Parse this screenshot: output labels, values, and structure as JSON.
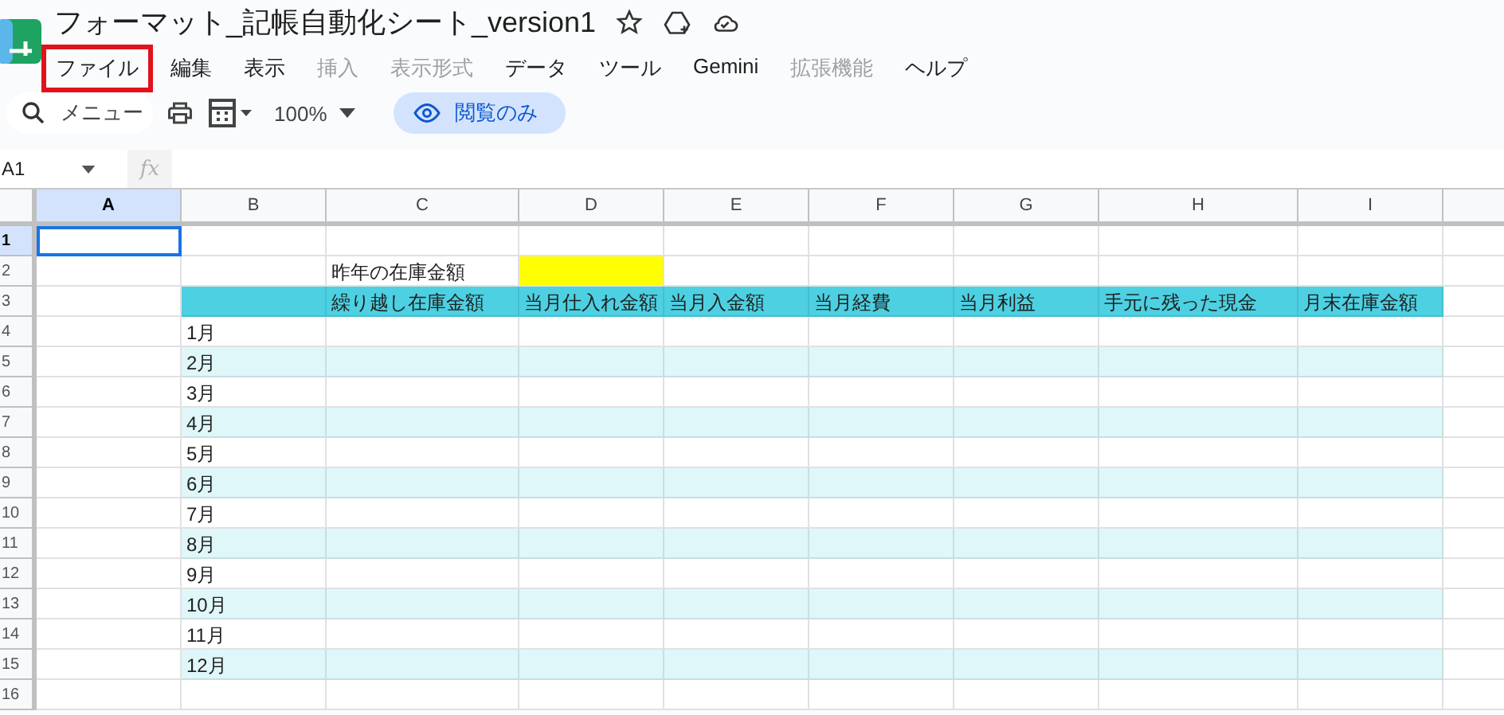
{
  "document": {
    "title": "フォーマット_記帳自動化シート_version1"
  },
  "menu": [
    {
      "label": "ファイル",
      "disabled": false,
      "highlighted": true
    },
    {
      "label": "編集",
      "disabled": false,
      "highlighted": false
    },
    {
      "label": "表示",
      "disabled": false,
      "highlighted": false
    },
    {
      "label": "挿入",
      "disabled": true,
      "highlighted": false
    },
    {
      "label": "表示形式",
      "disabled": true,
      "highlighted": false
    },
    {
      "label": "データ",
      "disabled": false,
      "highlighted": false
    },
    {
      "label": "ツール",
      "disabled": false,
      "highlighted": false
    },
    {
      "label": "Gemini",
      "disabled": false,
      "highlighted": false
    },
    {
      "label": "拡張機能",
      "disabled": true,
      "highlighted": false
    },
    {
      "label": "ヘルプ",
      "disabled": false,
      "highlighted": false
    }
  ],
  "toolbar": {
    "search_placeholder": "メニュー",
    "zoom": "100%",
    "view_only": "閲覧のみ"
  },
  "formula_bar": {
    "name_box": "A1",
    "fx": "fx"
  },
  "columns": [
    {
      "label": "A",
      "selected": true
    },
    {
      "label": "B",
      "selected": false
    },
    {
      "label": "C",
      "selected": false
    },
    {
      "label": "D",
      "selected": false
    },
    {
      "label": "E",
      "selected": false
    },
    {
      "label": "F",
      "selected": false
    },
    {
      "label": "G",
      "selected": false
    },
    {
      "label": "H",
      "selected": false
    },
    {
      "label": "I",
      "selected": false
    }
  ],
  "rows": [
    {
      "number": "1",
      "selected": true,
      "cells": [
        {
          "kind": "plain"
        },
        {
          "kind": "plain"
        },
        {
          "kind": "plain"
        },
        {
          "kind": "plain"
        },
        {
          "kind": "plain"
        },
        {
          "kind": "plain"
        },
        {
          "kind": "plain"
        },
        {
          "kind": "plain"
        },
        {
          "kind": "plain"
        }
      ]
    },
    {
      "number": "2",
      "selected": false,
      "cells": [
        {
          "kind": "plain"
        },
        {
          "kind": "plain"
        },
        {
          "kind": "plain",
          "text": "昨年の在庫金額"
        },
        {
          "kind": "highlight"
        },
        {
          "kind": "plain"
        },
        {
          "kind": "plain"
        },
        {
          "kind": "plain"
        },
        {
          "kind": "plain"
        },
        {
          "kind": "plain"
        }
      ]
    },
    {
      "number": "3",
      "selected": false,
      "cells": [
        {
          "kind": "plain"
        },
        {
          "kind": "header"
        },
        {
          "kind": "header",
          "text": "繰り越し在庫金額"
        },
        {
          "kind": "header",
          "text": "当月仕入れ金額"
        },
        {
          "kind": "header",
          "text": "当月入金額"
        },
        {
          "kind": "header",
          "text": "当月経費"
        },
        {
          "kind": "header",
          "text": "当月利益"
        },
        {
          "kind": "header",
          "text": "手元に残った現金"
        },
        {
          "kind": "header",
          "text": "月末在庫金額"
        }
      ]
    },
    {
      "number": "4",
      "selected": false,
      "cells": [
        {
          "kind": "plain"
        },
        {
          "kind": "plain",
          "text": "1月"
        },
        {
          "kind": "plain"
        },
        {
          "kind": "plain"
        },
        {
          "kind": "plain"
        },
        {
          "kind": "plain"
        },
        {
          "kind": "plain"
        },
        {
          "kind": "plain"
        },
        {
          "kind": "plain"
        }
      ]
    },
    {
      "number": "5",
      "selected": false,
      "cells": [
        {
          "kind": "plain"
        },
        {
          "kind": "band",
          "text": "2月"
        },
        {
          "kind": "band"
        },
        {
          "kind": "band"
        },
        {
          "kind": "band"
        },
        {
          "kind": "band"
        },
        {
          "kind": "band"
        },
        {
          "kind": "band"
        },
        {
          "kind": "band"
        }
      ]
    },
    {
      "number": "6",
      "selected": false,
      "cells": [
        {
          "kind": "plain"
        },
        {
          "kind": "plain",
          "text": "3月"
        },
        {
          "kind": "plain"
        },
        {
          "kind": "plain"
        },
        {
          "kind": "plain"
        },
        {
          "kind": "plain"
        },
        {
          "kind": "plain"
        },
        {
          "kind": "plain"
        },
        {
          "kind": "plain"
        }
      ]
    },
    {
      "number": "7",
      "selected": false,
      "cells": [
        {
          "kind": "plain"
        },
        {
          "kind": "band",
          "text": "4月"
        },
        {
          "kind": "band"
        },
        {
          "kind": "band"
        },
        {
          "kind": "band"
        },
        {
          "kind": "band"
        },
        {
          "kind": "band"
        },
        {
          "kind": "band"
        },
        {
          "kind": "band"
        }
      ]
    },
    {
      "number": "8",
      "selected": false,
      "cells": [
        {
          "kind": "plain"
        },
        {
          "kind": "plain",
          "text": "5月"
        },
        {
          "kind": "plain"
        },
        {
          "kind": "plain"
        },
        {
          "kind": "plain"
        },
        {
          "kind": "plain"
        },
        {
          "kind": "plain"
        },
        {
          "kind": "plain"
        },
        {
          "kind": "plain"
        }
      ]
    },
    {
      "number": "9",
      "selected": false,
      "cells": [
        {
          "kind": "plain"
        },
        {
          "kind": "band",
          "text": "6月"
        },
        {
          "kind": "band"
        },
        {
          "kind": "band"
        },
        {
          "kind": "band"
        },
        {
          "kind": "band"
        },
        {
          "kind": "band"
        },
        {
          "kind": "band"
        },
        {
          "kind": "band"
        }
      ]
    },
    {
      "number": "10",
      "selected": false,
      "cells": [
        {
          "kind": "plain"
        },
        {
          "kind": "plain",
          "text": "7月"
        },
        {
          "kind": "plain"
        },
        {
          "kind": "plain"
        },
        {
          "kind": "plain"
        },
        {
          "kind": "plain"
        },
        {
          "kind": "plain"
        },
        {
          "kind": "plain"
        },
        {
          "kind": "plain"
        }
      ]
    },
    {
      "number": "11",
      "selected": false,
      "cells": [
        {
          "kind": "plain"
        },
        {
          "kind": "band",
          "text": "8月"
        },
        {
          "kind": "band"
        },
        {
          "kind": "band"
        },
        {
          "kind": "band"
        },
        {
          "kind": "band"
        },
        {
          "kind": "band"
        },
        {
          "kind": "band"
        },
        {
          "kind": "band"
        }
      ]
    },
    {
      "number": "12",
      "selected": false,
      "cells": [
        {
          "kind": "plain"
        },
        {
          "kind": "plain",
          "text": "9月"
        },
        {
          "kind": "plain"
        },
        {
          "kind": "plain"
        },
        {
          "kind": "plain"
        },
        {
          "kind": "plain"
        },
        {
          "kind": "plain"
        },
        {
          "kind": "plain"
        },
        {
          "kind": "plain"
        }
      ]
    },
    {
      "number": "13",
      "selected": false,
      "cells": [
        {
          "kind": "plain"
        },
        {
          "kind": "band",
          "text": "10月"
        },
        {
          "kind": "band"
        },
        {
          "kind": "band"
        },
        {
          "kind": "band"
        },
        {
          "kind": "band"
        },
        {
          "kind": "band"
        },
        {
          "kind": "band"
        },
        {
          "kind": "band"
        }
      ]
    },
    {
      "number": "14",
      "selected": false,
      "cells": [
        {
          "kind": "plain"
        },
        {
          "kind": "plain",
          "text": "11月"
        },
        {
          "kind": "plain"
        },
        {
          "kind": "plain"
        },
        {
          "kind": "plain"
        },
        {
          "kind": "plain"
        },
        {
          "kind": "plain"
        },
        {
          "kind": "plain"
        },
        {
          "kind": "plain"
        }
      ]
    },
    {
      "number": "15",
      "selected": false,
      "cells": [
        {
          "kind": "plain"
        },
        {
          "kind": "band",
          "text": "12月"
        },
        {
          "kind": "band"
        },
        {
          "kind": "band"
        },
        {
          "kind": "band"
        },
        {
          "kind": "band"
        },
        {
          "kind": "band"
        },
        {
          "kind": "band"
        },
        {
          "kind": "band"
        }
      ]
    },
    {
      "number": "16",
      "selected": false,
      "cells": [
        {
          "kind": "plain"
        },
        {
          "kind": "plain"
        },
        {
          "kind": "plain"
        },
        {
          "kind": "plain"
        },
        {
          "kind": "plain"
        },
        {
          "kind": "plain"
        },
        {
          "kind": "plain"
        },
        {
          "kind": "plain"
        },
        {
          "kind": "plain"
        }
      ]
    }
  ]
}
